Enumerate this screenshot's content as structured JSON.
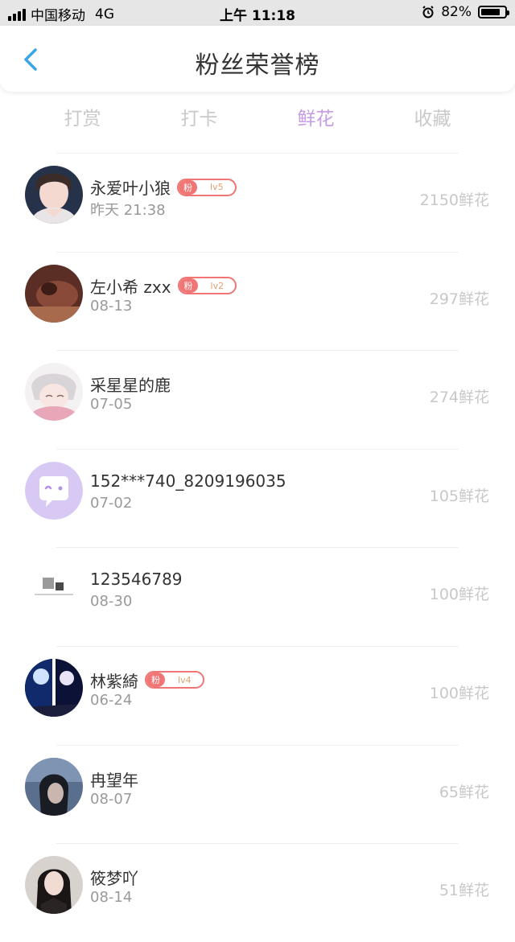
{
  "status_bar": {
    "carrier": "中国移动",
    "network": "4G",
    "time": "上午 11:18",
    "battery_percent": "82%",
    "battery_level": 0.82
  },
  "header": {
    "title": "粉丝荣誉榜"
  },
  "tabs": [
    {
      "label": "打赏",
      "active": false
    },
    {
      "label": "打卡",
      "active": false
    },
    {
      "label": "鲜花",
      "active": true
    },
    {
      "label": "收藏",
      "active": false
    }
  ],
  "colors": {
    "active_tab": "#c59be6",
    "badge": "#f07575",
    "badge_level": "#e3a06e",
    "back_arrow": "#3aa6e8"
  },
  "fans": [
    {
      "name": "永爱叶小狼",
      "date": "昨天 21:38",
      "count": "2150鲜花",
      "badge": {
        "label": "粉",
        "level": "lv5"
      }
    },
    {
      "name": "左小希 zxx",
      "date": "08-13",
      "count": "297鲜花",
      "badge": {
        "label": "粉",
        "level": "lv2"
      }
    },
    {
      "name": "采星星的鹿",
      "date": "07-05",
      "count": "274鲜花"
    },
    {
      "name": "152***740_8209196035",
      "date": "07-02",
      "count": "105鲜花"
    },
    {
      "name": "123546789",
      "date": "08-30",
      "count": "100鲜花"
    },
    {
      "name": "林紫綺",
      "date": "06-24",
      "count": "100鲜花",
      "badge": {
        "label": "粉",
        "level": "lv4"
      }
    },
    {
      "name": "冉望年",
      "date": "08-07",
      "count": "65鲜花"
    },
    {
      "name": "筱梦吖",
      "date": "08-14",
      "count": "51鲜花"
    }
  ]
}
